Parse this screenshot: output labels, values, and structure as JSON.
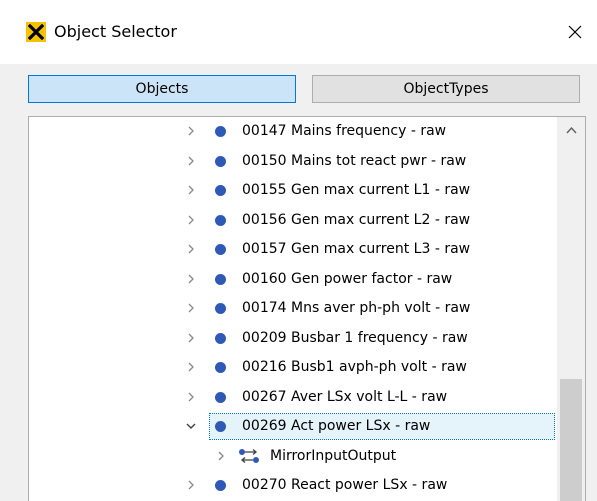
{
  "window": {
    "title": "Object Selector"
  },
  "tabs": [
    {
      "label": "Objects",
      "active": true
    },
    {
      "label": "ObjectTypes",
      "active": false
    }
  ],
  "tree": {
    "rows": [
      {
        "label": "00147 Mains frequency - raw",
        "expanded": false
      },
      {
        "label": "00150 Mains tot react pwr - raw",
        "expanded": false
      },
      {
        "label": "00155 Gen max current L1 - raw",
        "expanded": false
      },
      {
        "label": "00156 Gen max current L2 - raw",
        "expanded": false
      },
      {
        "label": "00157 Gen max current L3 - raw",
        "expanded": false
      },
      {
        "label": "00160 Gen power factor - raw",
        "expanded": false
      },
      {
        "label": "00174 Mns aver ph-ph volt - raw",
        "expanded": false
      },
      {
        "label": "00209 Busbar 1 frequency - raw",
        "expanded": false
      },
      {
        "label": "00216 Busb1 avph-ph volt - raw",
        "expanded": false
      },
      {
        "label": "00267 Aver LSx volt L-L - raw",
        "expanded": false
      },
      {
        "label": "00269 Act power LSx - raw",
        "expanded": true,
        "selected": true
      },
      {
        "label": "MirrorInputOutput",
        "child": true
      },
      {
        "label": "00270 React power LSx - raw",
        "expanded": false
      }
    ]
  },
  "colors": {
    "accent": "#0078d7",
    "dot": "#2f59b5",
    "app_icon": "#f3c300"
  }
}
